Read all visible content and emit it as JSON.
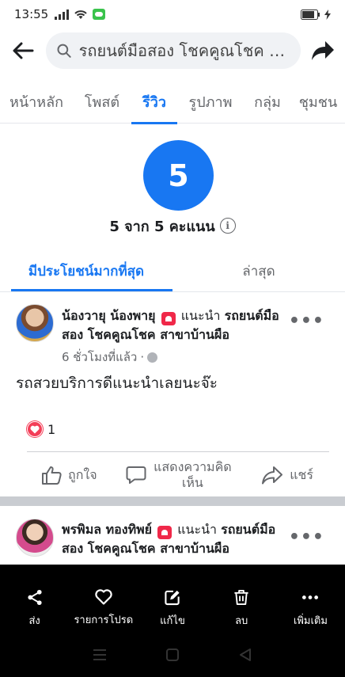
{
  "status": {
    "time": "13:55"
  },
  "header": {
    "search_text": "รถยนต์มือสอง โชคคูณโชค ส..."
  },
  "tabs": [
    {
      "label": "หน้าหลัก"
    },
    {
      "label": "โพสต์"
    },
    {
      "label": "รีวิว",
      "active": true
    },
    {
      "label": "รูปภาพ"
    },
    {
      "label": "กลุ่ม"
    },
    {
      "label": "ชุมชน"
    }
  ],
  "rating": {
    "value": "5",
    "summary": "5 จาก 5 คะแนน"
  },
  "sort_tabs": [
    {
      "label": "มีประโยชน์มากที่สุด",
      "active": true
    },
    {
      "label": "ล่าสุด"
    }
  ],
  "reviews": [
    {
      "author": "น้องวายุ น้องพายุ",
      "recommend_word": "แนะนำ",
      "page_line1": "รถยนต์มือ",
      "page_line2": "สอง โชคคูณโชค สาขาบ้านผือ",
      "time": "6 ชั่วโมงที่แล้ว",
      "text": "รถสวยบริการดีแนะนำเลยนะจ๊ะ",
      "reaction_count": "1"
    },
    {
      "author": "พรพิมล ทองทิพย์",
      "recommend_word": "แนะนำ",
      "page_line1": "รถยนต์มือ",
      "page_line2": "สอง โชคคูณโชค สาขาบ้านผือ"
    }
  ],
  "actions": {
    "like": "ถูกใจ",
    "comment_line1": "แสดงความคิด",
    "comment_line2": "เห็น",
    "share": "แชร์"
  },
  "bottom_menu": [
    {
      "label": "ส่ง",
      "icon": "share-nodes-icon"
    },
    {
      "label": "รายการโปรด",
      "icon": "heart-outline-icon"
    },
    {
      "label": "แก้ไข",
      "icon": "edit-icon"
    },
    {
      "label": "ลบ",
      "icon": "trash-icon"
    },
    {
      "label": "เพิ่มเติม",
      "icon": "more-dots-icon"
    }
  ],
  "colors": {
    "accent": "#1877f2",
    "reaction": "#f33e58",
    "overlay": "#000000"
  }
}
